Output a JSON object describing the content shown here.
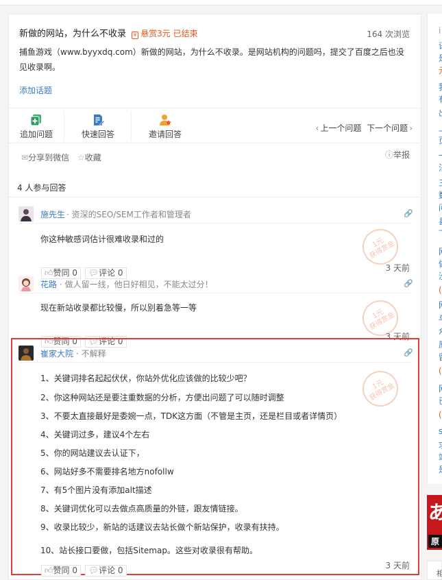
{
  "question": {
    "title": "新做的网站，为什么不收录",
    "reward": "悬赏3元 已结束",
    "views": "164 次浏览",
    "body": "捕鱼游戏（www.byyxdq.com）新做的网站，为什么不收录。是网站机构的问题吗，提交了百度之后也没见收录啊。",
    "add_topic": "添加话题"
  },
  "actions": {
    "add_question": "追加问题",
    "quick_answer": "快速回答",
    "invite_answer": "邀请回答",
    "prev": "上一个问题",
    "next": "下一个问题",
    "share": "分享到微信",
    "favorite": "收藏",
    "report": "举报"
  },
  "answer_count": "4 人参与回答",
  "stamp": {
    "line1": "1元",
    "line2": "获得赏金"
  },
  "answers": [
    {
      "name": "施先生",
      "desc": "资深的SEO/SEM工作者和管理者",
      "text": "你这种敏感词估计很难收录和过的",
      "like": "赞同 0",
      "comment": "评论 0",
      "time": "3 天前"
    },
    {
      "name": "花路",
      "desc": "做人留一线，他日好相见，不能太过分！",
      "text": "现在新站收录都比较慢，所以别着急等一等",
      "like": "赞同 0",
      "comment": "评论 0",
      "time": "3 天前"
    },
    {
      "name": "崔家大院",
      "desc": "不解释",
      "lines": [
        "1、关键词排名起起伏伏，你站外优化应该做的比较少吧？",
        "2、你这种网站还是要注重数据的分析，方便出问题了可以随时调整",
        "3、不要太直接最好是委婉一点，TDK这方面（不管是主页，还是栏目或者详情页）",
        "4、关键词过多，建议4个左右",
        "5、你的网站建议去认证下，",
        "6、网站好多不需要排名地方nofollw",
        "7、有5个图片没有添加alt描述",
        "8、关键词优化可以去做点高质量的外链，跟友情链接。",
        "9、收录比较少，新站的话建议去站长做个新站保护，收录有扶持。",
        "10、站长接口要做，包括Sitemap。这些对收录很有帮助。"
      ],
      "like": "赞同 0",
      "comment": "评论 0",
      "time": "3 天前"
    }
  ],
  "sidebar": {
    "chars": [
      "i",
      "语",
      "是",
      "元",
      "我",
      "有",
      "出",
      "上",
      "页",
      "一",
      "法",
      "三",
      "数",
      "问",
      "县",
      "下",
      "网",
      "做",
      "没",
      "(3",
      "网",
      "与",
      "众",
      "原",
      "留",
      "(5",
      "网",
      "已",
      "(8",
      "si",
      "求",
      "站",
      "是"
    ],
    "banner_big": "あ",
    "banner_sub": "原",
    "bottom": "相"
  },
  "colors": {
    "link": "#3a7bc8",
    "reward": "#e8561a",
    "highlight": "#e23b3b"
  }
}
